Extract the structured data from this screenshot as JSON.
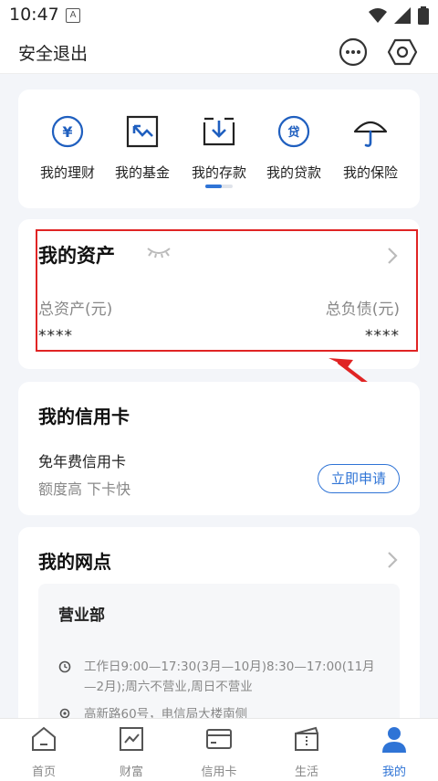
{
  "status": {
    "time": "10:47",
    "notif_letter": "A"
  },
  "topbar": {
    "logout_label": "安全退出"
  },
  "quick_menu": {
    "items": [
      {
        "label": "我的理财",
        "icon": "yuan-coin-icon",
        "glyph": "¥"
      },
      {
        "label": "我的基金",
        "icon": "fund-chart-icon"
      },
      {
        "label": "我的存款",
        "icon": "deposit-box-icon"
      },
      {
        "label": "我的贷款",
        "icon": "loan-coin-icon",
        "glyph": "贷"
      },
      {
        "label": "我的保险",
        "icon": "umbrella-icon"
      }
    ],
    "page_index": 1,
    "page_count": 2
  },
  "assets": {
    "title": "我的资产",
    "total_assets_label": "总资产(元)",
    "total_liabilities_label": "总负债(元)",
    "total_assets_value": "****",
    "total_liabilities_value": "****"
  },
  "credit_card": {
    "title": "我的信用卡",
    "promo_title": "免年费信用卡",
    "promo_sub": "额度高 下卡快",
    "apply_label": "立即申请"
  },
  "branch": {
    "title": "我的网点",
    "name": "营业部",
    "hours": "工作日9:00—17:30(3月—10月)8:30—17:00(11月—2月);周六不营业,周日不营业",
    "address": "高新路60号，电信局大楼南侧"
  },
  "tabbar": {
    "tabs": [
      {
        "label": "首页",
        "icon": "home-icon"
      },
      {
        "label": "财富",
        "icon": "wealth-icon"
      },
      {
        "label": "信用卡",
        "icon": "credit-card-icon"
      },
      {
        "label": "生活",
        "icon": "life-ticket-icon"
      },
      {
        "label": "我的",
        "icon": "profile-icon"
      }
    ],
    "active_index": 4
  },
  "colors": {
    "accent": "#2f74d6",
    "highlight_red": "#e02424",
    "muted": "#888888"
  }
}
